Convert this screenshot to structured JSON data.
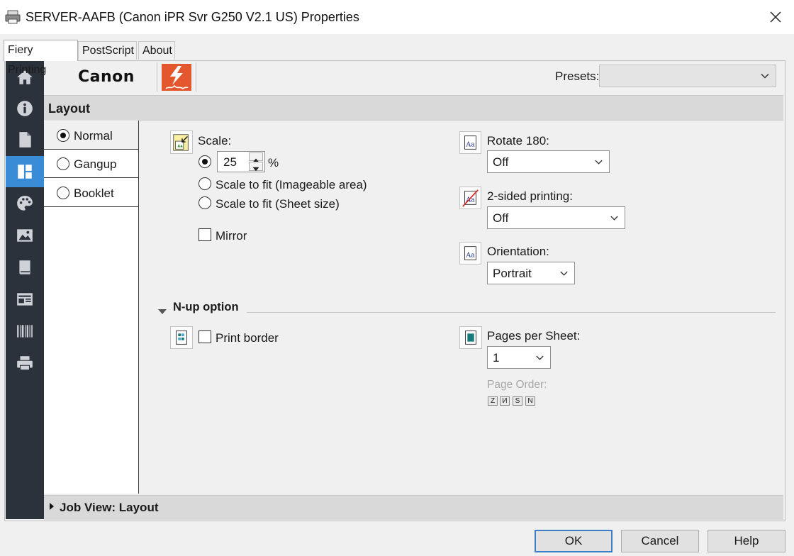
{
  "window": {
    "title": "SERVER-AAFB (Canon iPR Svr G250 V2.1 US) Properties"
  },
  "tabs": [
    {
      "label": "Fiery Printing",
      "active": true
    },
    {
      "label": "PostScript",
      "active": false
    },
    {
      "label": "About",
      "active": false
    }
  ],
  "header": {
    "brand": "Canon",
    "presets_label": "Presets:",
    "presets_value": ""
  },
  "section": {
    "title": "Layout"
  },
  "sidebar": {
    "items": [
      {
        "name": "home-icon"
      },
      {
        "name": "info-icon"
      },
      {
        "name": "document-icon"
      },
      {
        "name": "layout-icon",
        "active": true
      },
      {
        "name": "color-palette-icon"
      },
      {
        "name": "image-icon"
      },
      {
        "name": "book-icon"
      },
      {
        "name": "stamp-icon"
      },
      {
        "name": "barcode-icon"
      },
      {
        "name": "printer-icon"
      }
    ]
  },
  "modes": [
    {
      "label": "Normal",
      "selected": true
    },
    {
      "label": "Gangup",
      "selected": false
    },
    {
      "label": "Booklet",
      "selected": false
    }
  ],
  "scale": {
    "label": "Scale:",
    "value": "25",
    "unit": "%",
    "fit_imageable": "Scale to fit (Imageable area)",
    "fit_sheet": "Scale to fit (Sheet size)",
    "mirror": "Mirror"
  },
  "rotate": {
    "label": "Rotate 180:",
    "value": "Off"
  },
  "duplex": {
    "label": "2-sided printing:",
    "value": "Off"
  },
  "orientation": {
    "label": "Orientation:",
    "value": "Portrait"
  },
  "nup": {
    "title": "N-up option",
    "print_border": "Print border",
    "pages_label": "Pages per Sheet:",
    "pages_value": "1",
    "page_order_label": "Page Order:"
  },
  "jobview": {
    "label": "Job View: Layout"
  },
  "buttons": {
    "ok": "OK",
    "cancel": "Cancel",
    "help": "Help"
  },
  "colors": {
    "accent": "#3b8cd6",
    "sidebar_bg": "#2c323c",
    "fiery_red": "#e4572e"
  }
}
